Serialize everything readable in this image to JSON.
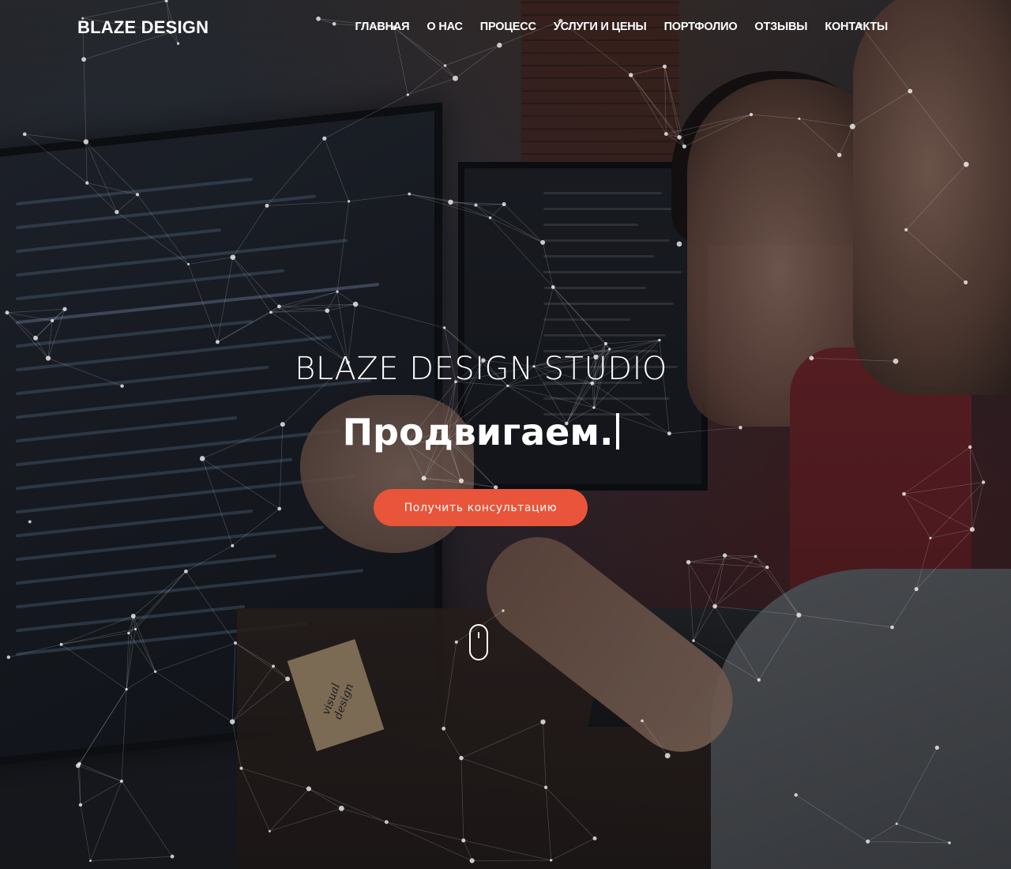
{
  "header": {
    "logo": "BLAZE DESIGN",
    "nav": [
      {
        "label": "ГЛАВНАЯ"
      },
      {
        "label": "О НАС"
      },
      {
        "label": "ПРОЦЕСС"
      },
      {
        "label": "УСЛУГИ И ЦЕНЫ"
      },
      {
        "label": "ПОРТФОЛИО"
      },
      {
        "label": "ОТЗЫВЫ"
      },
      {
        "label": "КОНТАКТЫ"
      }
    ]
  },
  "hero": {
    "title": "BLAZE DESIGN STUDIO",
    "typed_text": "Продвигаем.",
    "cta_label": "Получить консультацию",
    "accent_color": "#e8553a"
  },
  "background": {
    "sticky_note_text": "visual design"
  }
}
